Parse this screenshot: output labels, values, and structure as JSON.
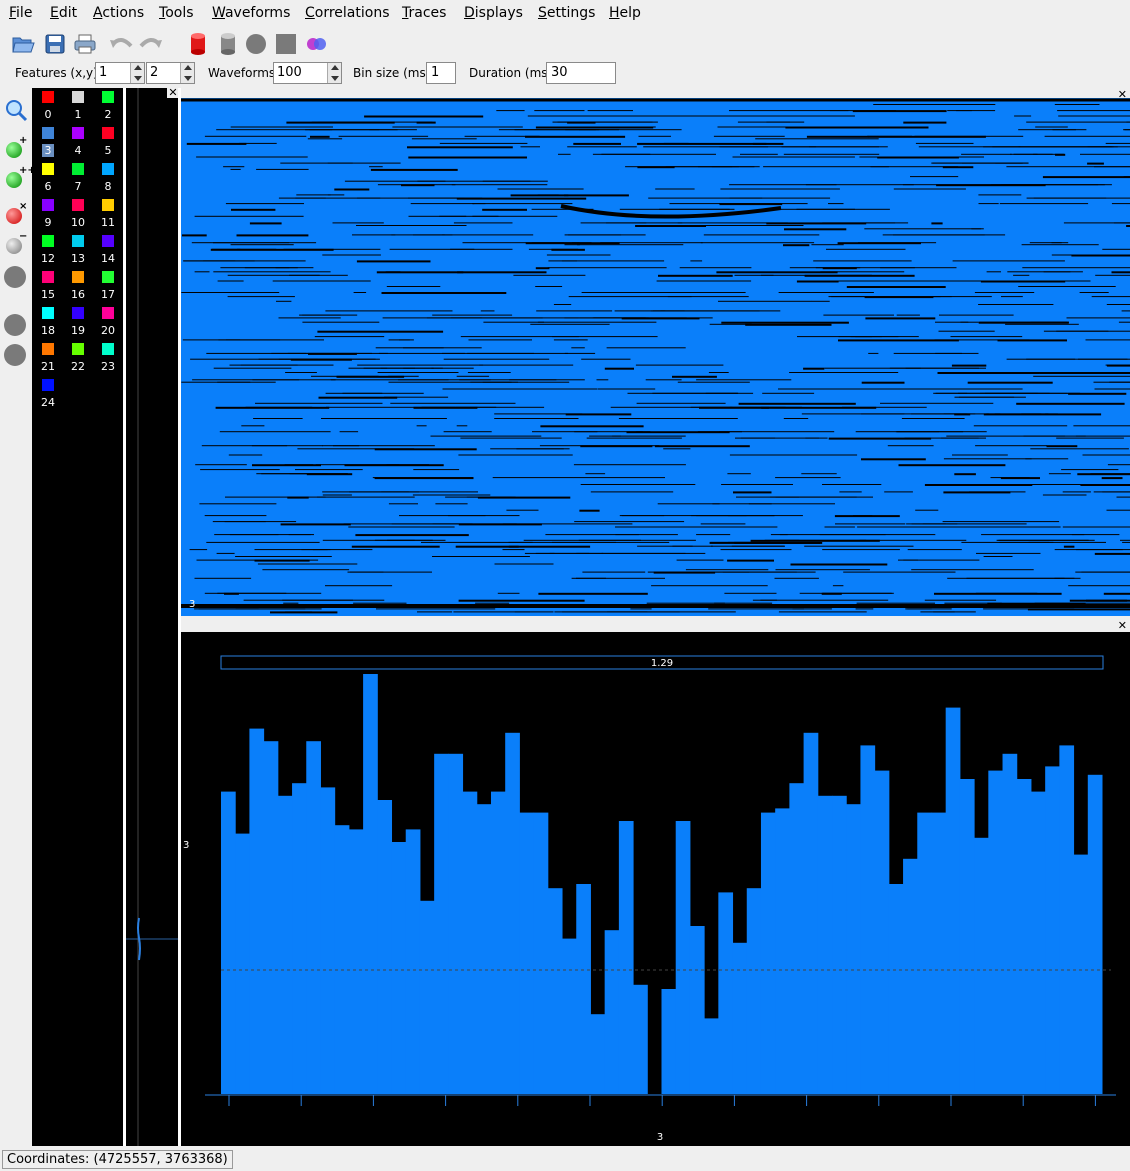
{
  "menu": [
    {
      "label": "File"
    },
    {
      "label": "Edit"
    },
    {
      "label": "Actions"
    },
    {
      "label": "Tools"
    },
    {
      "label": "Waveforms"
    },
    {
      "label": "Correlations"
    },
    {
      "label": "Traces"
    },
    {
      "label": "Displays"
    },
    {
      "label": "Settings"
    },
    {
      "label": "Help"
    }
  ],
  "toolbar": {
    "icons": [
      "open-folder-icon",
      "save-icon",
      "print-icon",
      "undo-icon",
      "redo-icon",
      "red-cylinder-icon",
      "gray-cylinder-icon",
      "gray-circle-icon",
      "gray-square-icon",
      "venn-icon"
    ]
  },
  "controls": {
    "features_label": "Features (x,y)",
    "feature_x": "1",
    "feature_y": "2",
    "waveforms_label": "Waveforms",
    "waveforms_value": "100",
    "binsize_label": "Bin size (ms)",
    "binsize_value": "1",
    "duration_label": "Duration (ms)",
    "duration_value": "30"
  },
  "palette": [
    {
      "num": "0",
      "color": "#ff0000"
    },
    {
      "num": "1",
      "color": "#d8d8d8"
    },
    {
      "num": "2",
      "color": "#00ff33"
    },
    {
      "num": "3",
      "color": "#3f84d8"
    },
    {
      "num": "4",
      "color": "#aa00ff"
    },
    {
      "num": "5",
      "color": "#ff0022"
    },
    {
      "num": "6",
      "color": "#ffff00"
    },
    {
      "num": "7",
      "color": "#00ee33"
    },
    {
      "num": "8",
      "color": "#00a6ff"
    },
    {
      "num": "9",
      "color": "#8800ff"
    },
    {
      "num": "10",
      "color": "#ff0055"
    },
    {
      "num": "11",
      "color": "#ffcc00"
    },
    {
      "num": "12",
      "color": "#00ff22"
    },
    {
      "num": "13",
      "color": "#00ccee"
    },
    {
      "num": "14",
      "color": "#5500ff"
    },
    {
      "num": "15",
      "color": "#ff0077"
    },
    {
      "num": "16",
      "color": "#ff9900"
    },
    {
      "num": "17",
      "color": "#22ff33"
    },
    {
      "num": "18",
      "color": "#00ffff"
    },
    {
      "num": "19",
      "color": "#3300ff"
    },
    {
      "num": "20",
      "color": "#ff0099"
    },
    {
      "num": "21",
      "color": "#ff7700"
    },
    {
      "num": "22",
      "color": "#66ff00"
    },
    {
      "num": "23",
      "color": "#00ffcc"
    },
    {
      "num": "24",
      "color": "#0011ff"
    }
  ],
  "raster": {
    "label": "3",
    "fill": "#0a7ffa"
  },
  "histogram": {
    "legend_value": "1.29",
    "y_label": "3",
    "x_label": "3",
    "bar_color": "#0a7ffa",
    "values": [
      0.72,
      0.62,
      0.87,
      0.84,
      0.71,
      0.74,
      0.84,
      0.73,
      0.64,
      0.63,
      1.0,
      0.7,
      0.6,
      0.63,
      0.46,
      0.81,
      0.81,
      0.72,
      0.69,
      0.72,
      0.86,
      0.67,
      0.67,
      0.49,
      0.37,
      0.5,
      0.19,
      0.39,
      0.65,
      0.26,
      0.0,
      0.25,
      0.65,
      0.4,
      0.18,
      0.48,
      0.36,
      0.49,
      0.67,
      0.68,
      0.74,
      0.86,
      0.71,
      0.71,
      0.69,
      0.83,
      0.77,
      0.5,
      0.56,
      0.67,
      0.67,
      0.92,
      0.75,
      0.61,
      0.77,
      0.81,
      0.75,
      0.72,
      0.78,
      0.83,
      0.57,
      0.76
    ]
  },
  "status": {
    "coordinates": "Coordinates: (4725557, 3763368)"
  }
}
